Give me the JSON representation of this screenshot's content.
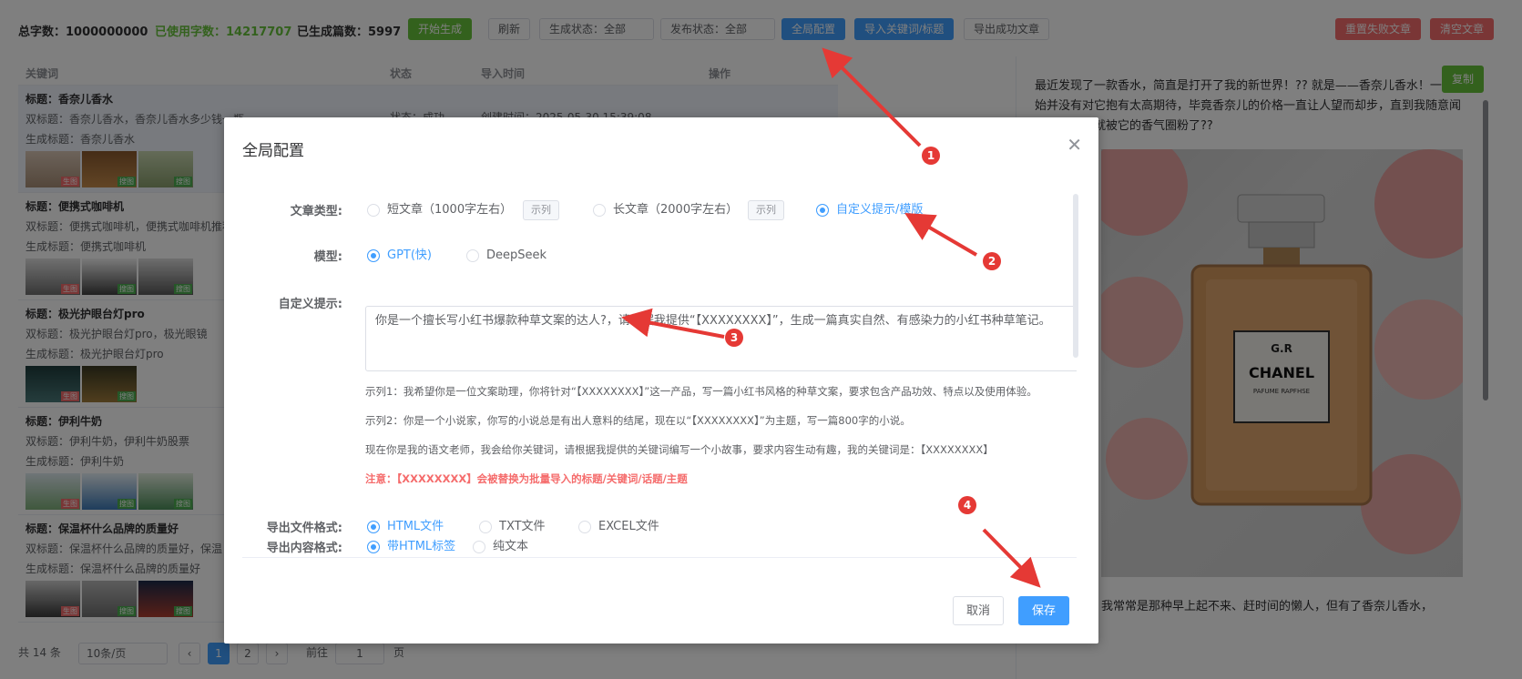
{
  "toolbar": {
    "total_words_label": "总字数：1000000000",
    "used_words_label": "已使用字数：14217707",
    "generated_label": "已生成篇数：5997",
    "start_btn": "开始生成",
    "refresh_btn": "刷新",
    "gen_status_select": "生成状态：全部",
    "pub_status_select": "发布状态：全部",
    "global_config_btn": "全局配置",
    "import_btn": "导入关键词/标题",
    "export_btn": "导出成功文章",
    "reset_failed_btn": "重置失败文章",
    "clear_btn": "清空文章"
  },
  "table": {
    "headers": [
      "关键词",
      "状态",
      "导入时间",
      "操作"
    ],
    "rows": [
      {
        "title": "标题：香奈儿香水",
        "sub1": "双标题：香奈儿香水，香奈儿香水多少钱一瓶",
        "sub2": "生成标题：香奈儿香水",
        "status": "状态：成功",
        "time": "创建时间：2025-05-30 15:39:08"
      },
      {
        "title": "标题：便携式咖啡机",
        "sub1": "双标题：便携式咖啡机，便携式咖啡机推荐",
        "sub2": "生成标题：便携式咖啡机",
        "status": "",
        "time": ""
      },
      {
        "title": "标题：极光护眼台灯pro",
        "sub1": "双标题：极光护眼台灯pro，极光眼镜",
        "sub2": "生成标题：极光护眼台灯pro",
        "status": "",
        "time": ""
      },
      {
        "title": "标题：伊利牛奶",
        "sub1": "双标题：伊利牛奶，伊利牛奶股票",
        "sub2": "生成标题：伊利牛奶",
        "status": "",
        "time": ""
      },
      {
        "title": "标题：保温杯什么品牌的质量好",
        "sub1": "双标题：保温杯什么品牌的质量好，保温",
        "sub2": "生成标题：保温杯什么品牌的质量好",
        "status": "",
        "time": ""
      }
    ],
    "tag_gen": "生图",
    "tag_search": "搜图"
  },
  "pager": {
    "total": "共 14 条",
    "page_size": "10条/页",
    "page1": "1",
    "page2": "2",
    "goto": "前往",
    "goto_value": "1",
    "page_unit": "页"
  },
  "preview": {
    "copy_btn": "复制",
    "text1": "最近发现了一款香水，简直是打开了我的新世界！?? 就是——香奈儿香水！一开始并没有对它抱有太高期待，毕竟香奈儿的价格一直让人望而却步，直到我随意闻试香，瞬间就被它的香气圈粉了??",
    "text2": "我常常是那种早上起不来、赶时间的懒人，但有了香奈儿香水，",
    "bottle_line1": "G.R",
    "bottle_line2": "CHANEL",
    "bottle_line3": "PAFUME RAPFHSE"
  },
  "modal": {
    "title": "全局配置",
    "article_type_label": "文章类型:",
    "opt_short": "短文章（1000字左右）",
    "opt_long": "长文章（2000字左右）",
    "opt_custom": "自定义提示/模版",
    "example_btn": "示列",
    "model_label": "模型:",
    "opt_gpt": "GPT(快)",
    "opt_deepseek": "DeepSeek",
    "custom_prompt_label": "自定义提示:",
    "prompt_text": "你是一个擅长写小红书爆款种草文案的达人?，请根据我提供“【XXXXXXXX】”，生成一篇真实自然、有感染力的小红书种草笔记。",
    "hint1": "示列1：我希望你是一位文案助理，你将针对“【XXXXXXXX】”这一产品，写一篇小红书风格的种草文案，要求包含产品功效、特点以及使用体验。",
    "hint2": "示列2：你是一个小说家，你写的小说总是有出人意料的结尾，现在以“【XXXXXXXX】”为主题，写一篇800字的小说。",
    "hint3": "现在你是我的语文老师，我会给你关键词，请根据我提供的关键词编写一个小故事，要求内容生动有趣，我的关键词是：【XXXXXXXX】",
    "hint_warning": "注意：【XXXXXXXX】会被替换为批量导入的标题/关键词/话题/主题",
    "export_format_label": "导出文件格式:",
    "opt_html": "HTML文件",
    "opt_txt": "TXT文件",
    "opt_excel": "EXCEL文件",
    "export_content_label": "导出内容格式:",
    "opt_html_tag": "带HTML标签",
    "opt_plain": "纯文本",
    "cancel_btn": "取消",
    "save_btn": "保存"
  },
  "annotations": {
    "n1": "1",
    "n2": "2",
    "n3": "3",
    "n4": "4",
    "arrow_color": "#e53935"
  }
}
